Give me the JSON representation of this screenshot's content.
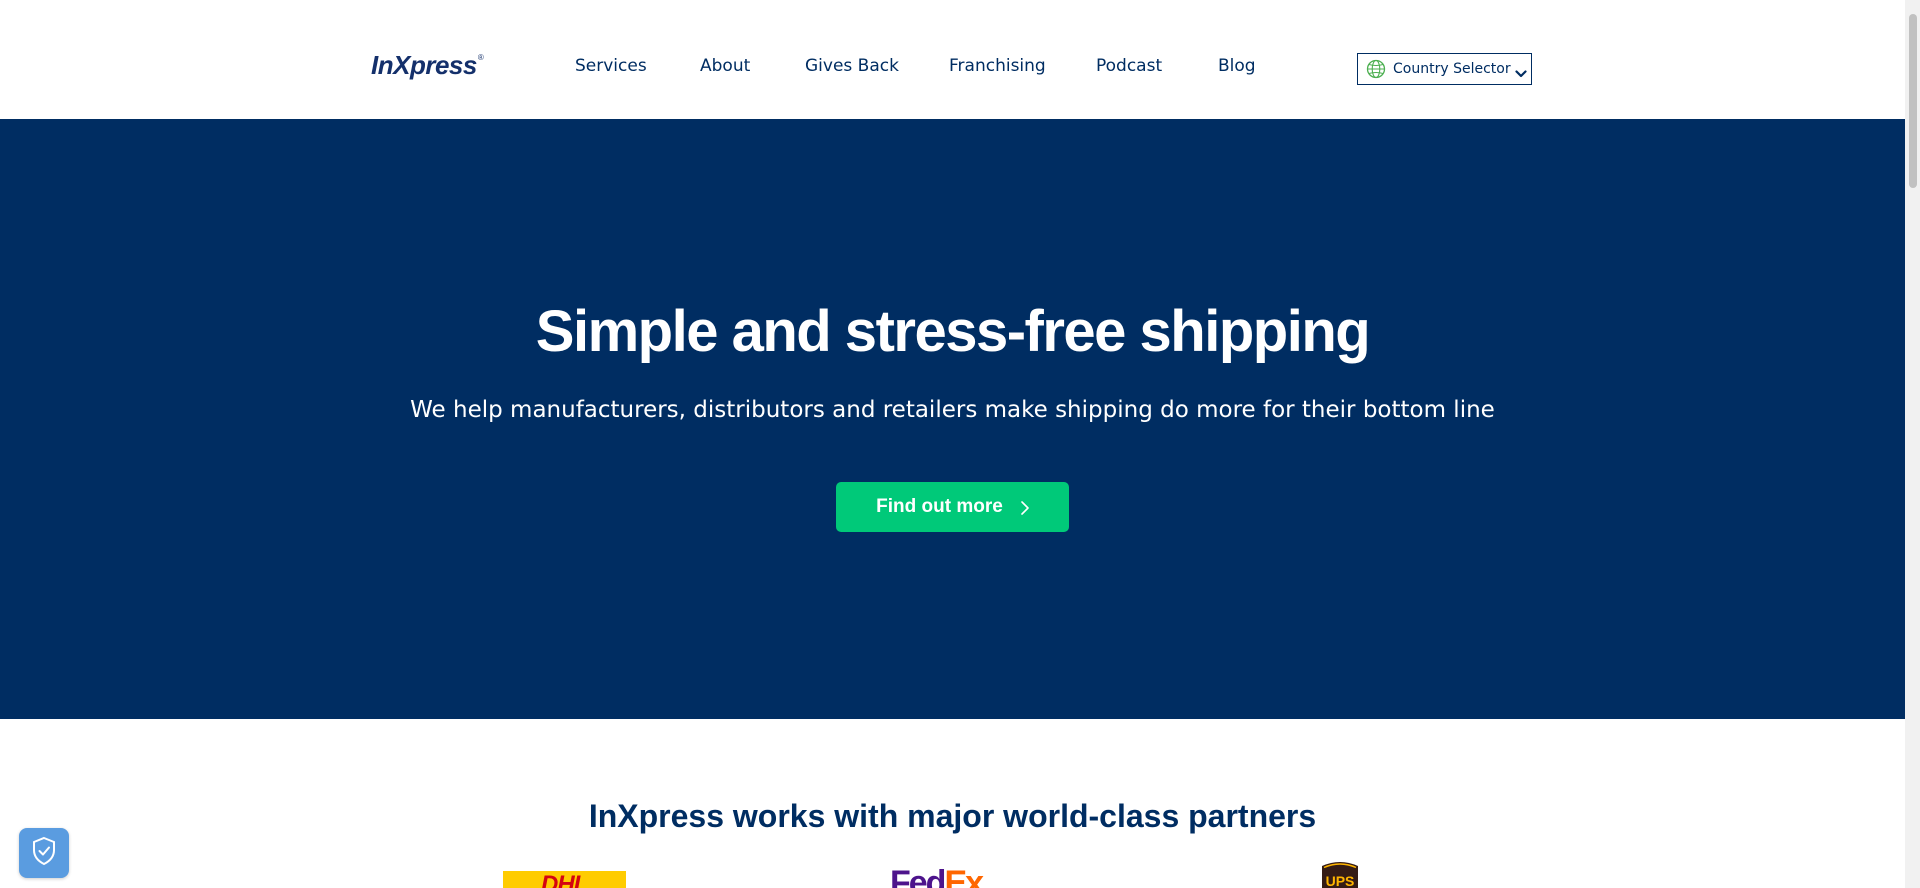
{
  "stray_text": ">",
  "header": {
    "logo_text": "InXpress",
    "logo_mark": "®",
    "nav": [
      {
        "label": "Services"
      },
      {
        "label": "About"
      },
      {
        "label": "Gives Back"
      },
      {
        "label": "Franchising"
      },
      {
        "label": "Podcast"
      },
      {
        "label": "Blog"
      }
    ],
    "country_selector": {
      "label": "Country Selector",
      "icon": "globe-icon"
    }
  },
  "hero": {
    "title": "Simple and stress-free shipping",
    "subtitle": "We help manufacturers, distributors and retailers make shipping do more for their bottom line",
    "cta_label": "Find out more"
  },
  "partners": {
    "heading": "InXpress works with major world-class partners",
    "logos": [
      {
        "name": "DHL",
        "text": "DHL"
      },
      {
        "name": "FedEx",
        "text_fed": "Fed",
        "text_ex": "Ex"
      },
      {
        "name": "UPS",
        "text": "UPS"
      }
    ]
  },
  "colors": {
    "navy": "#002d62",
    "accent_green": "#00c979",
    "badge_blue": "#5a9ce0"
  }
}
